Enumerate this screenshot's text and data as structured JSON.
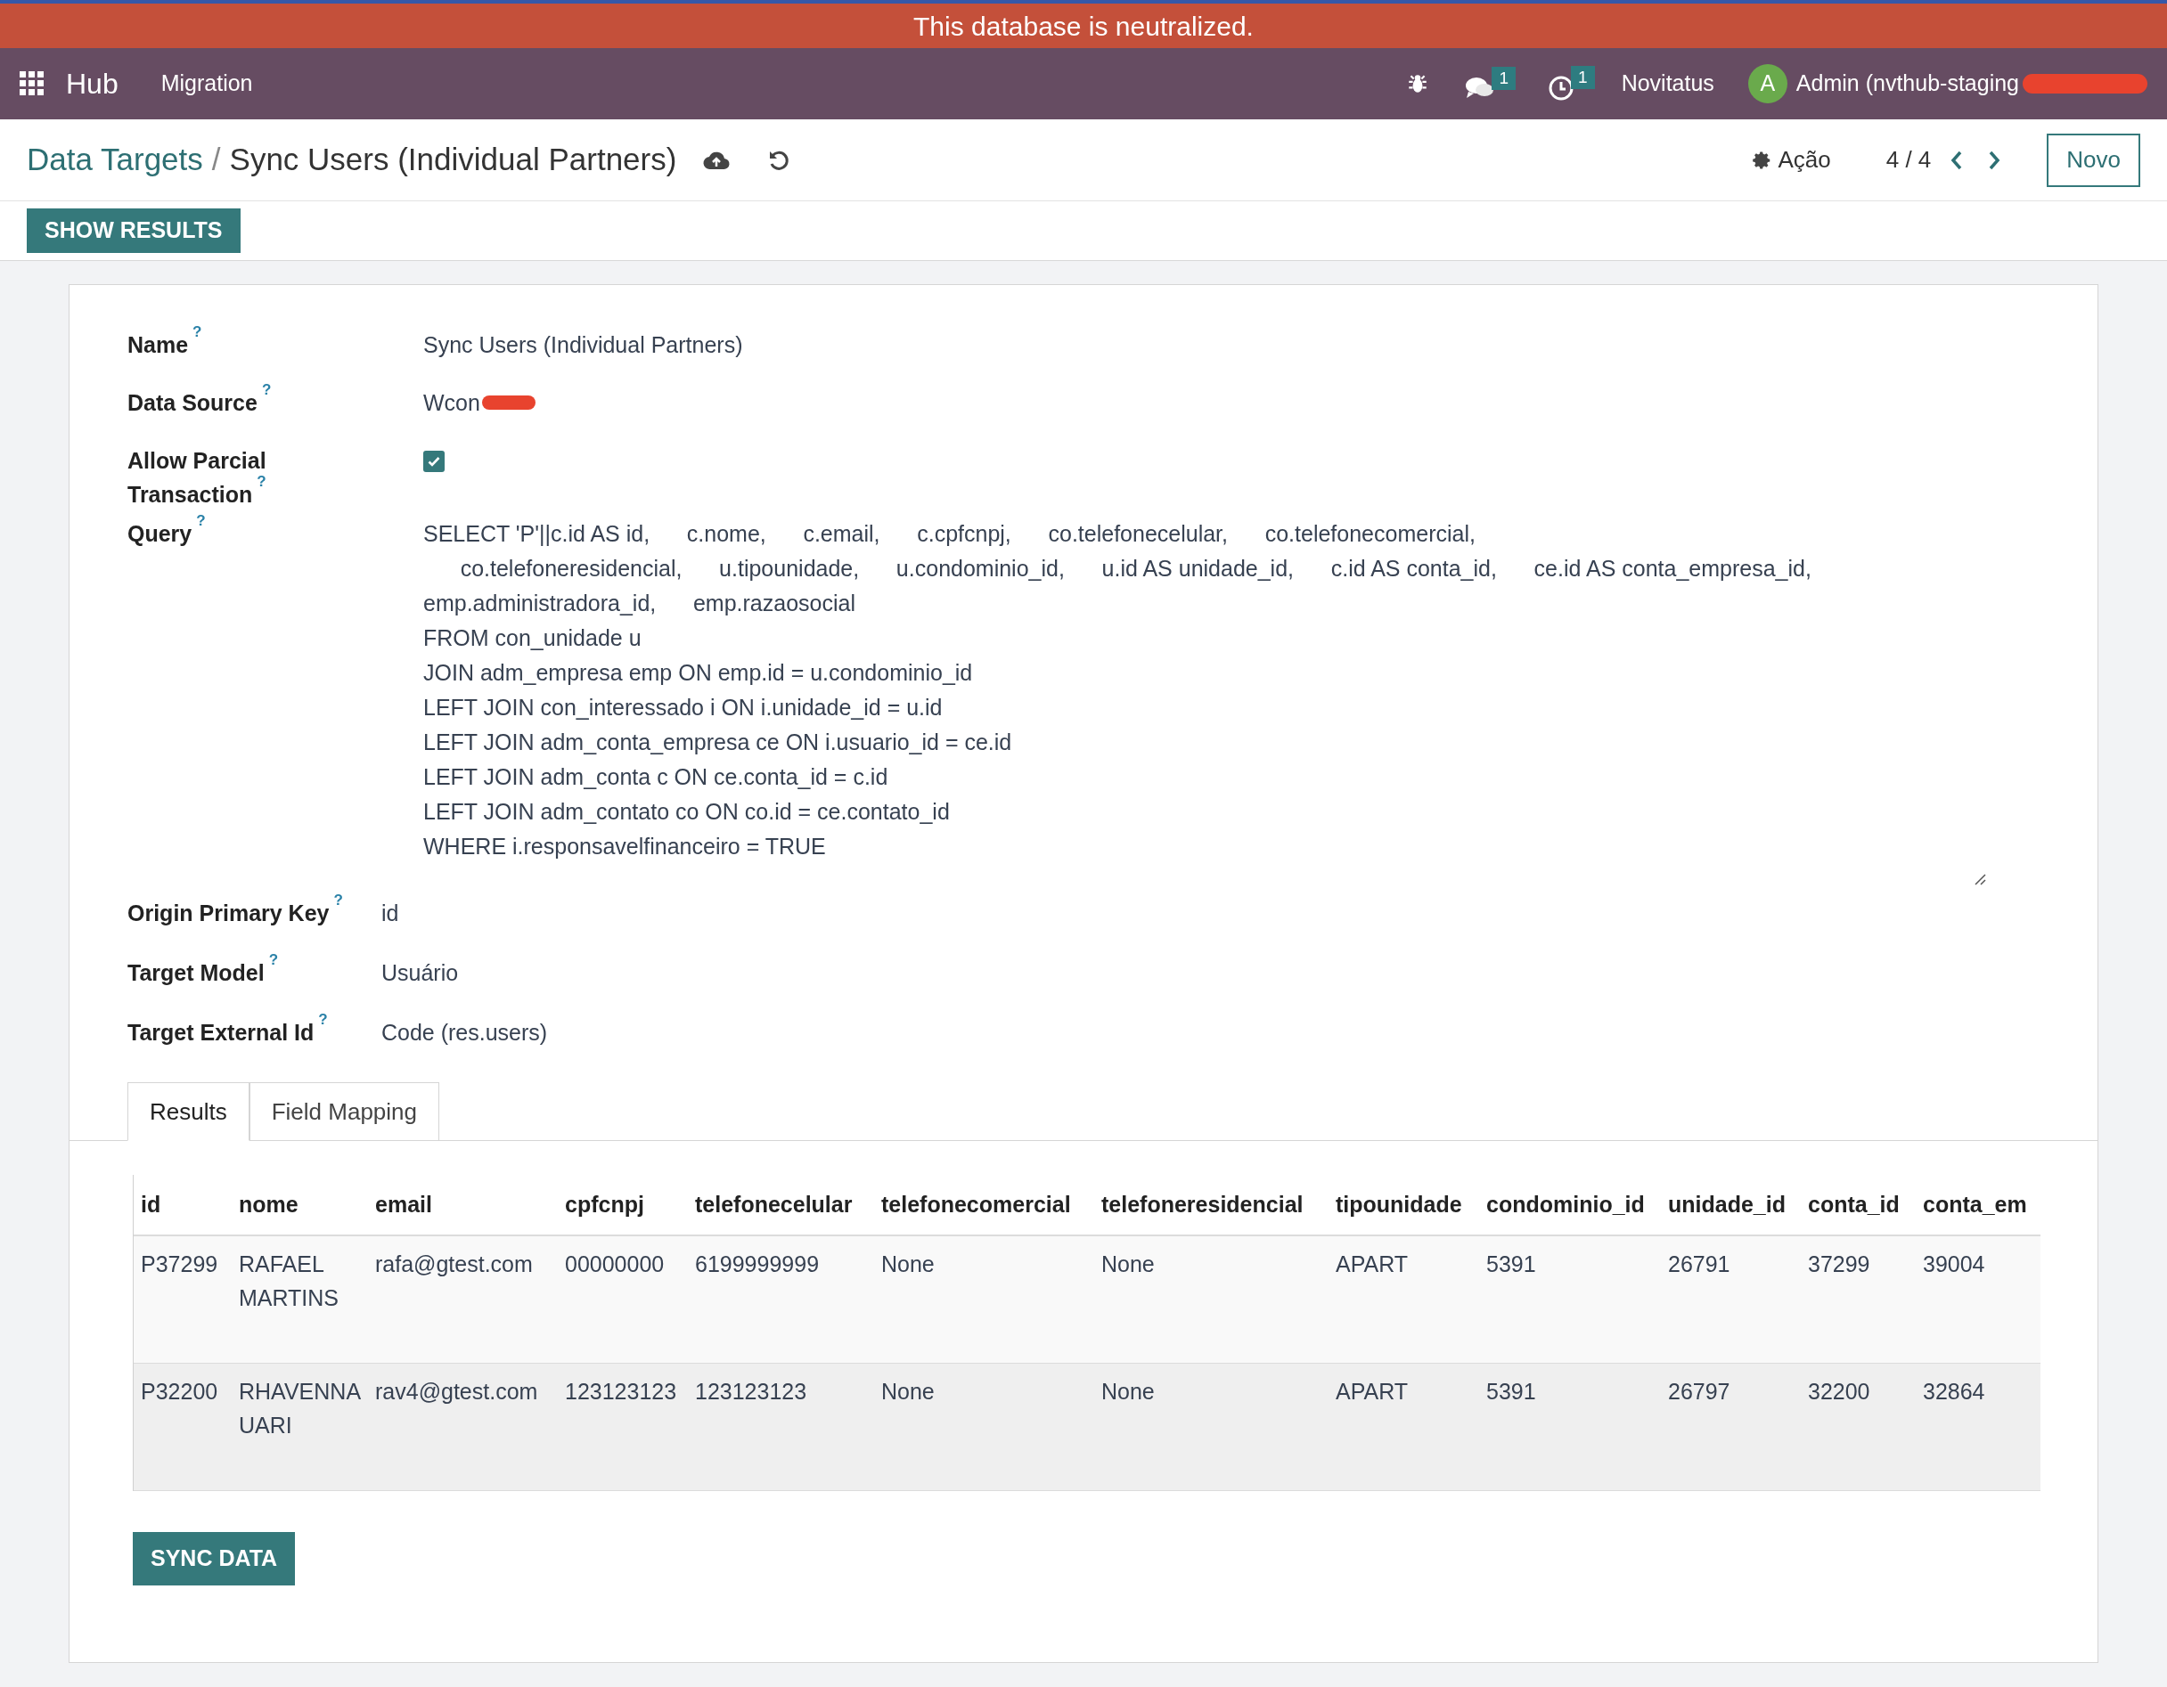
{
  "banner": {
    "text": "This database is neutralized."
  },
  "navbar": {
    "app": "Hub",
    "menus": [
      "Migration"
    ],
    "messages_count": "1",
    "activities_count": "1",
    "company": "Novitatus",
    "avatar_letter": "A",
    "user": "Admin (nvthub-staging"
  },
  "breadcrumb": {
    "parent": "Data Targets",
    "separator": "/",
    "current": "Sync Users (Individual Partners)"
  },
  "controls": {
    "action": "Ação",
    "pager": "4 / 4",
    "new_button": "Novo",
    "show_results": "SHOW RESULTS"
  },
  "form": {
    "fields": [
      {
        "kind": "text",
        "label": "Name",
        "value": "Sync Users (Individual Partners)"
      },
      {
        "kind": "redacted",
        "label": "Data Source",
        "value": "Wcon"
      },
      {
        "kind": "checkbox",
        "label": "Allow Parcial Transaction",
        "checked": true
      },
      {
        "kind": "query",
        "label": "Query",
        "lines": [
          "SELECT 'P'||c.id AS id,      c.nome,      c.email,      c.cpfcnpj,      co.telefonecelular,      co.telefonecomercial,",
          "      co.telefoneresidencial,      u.tipounidade,      u.condominio_id,      u.id AS unidade_id,      c.id AS conta_id,      ce.id AS conta_empresa_id,",
          "emp.administradora_id,      emp.razaosocial",
          "FROM con_unidade u",
          "JOIN adm_empresa emp ON emp.id = u.condominio_id",
          "LEFT JOIN con_interessado i ON i.unidade_id = u.id",
          "LEFT JOIN adm_conta_empresa ce ON i.usuario_id = ce.id",
          "LEFT JOIN adm_conta c ON ce.conta_id = c.id",
          "LEFT JOIN adm_contato co ON co.id = ce.contato_id",
          "WHERE i.responsavelfinanceiro = TRUE"
        ]
      },
      {
        "kind": "short",
        "label": "Origin Primary Key",
        "value": "id"
      },
      {
        "kind": "short",
        "label": "Target Model",
        "value": "Usuário"
      },
      {
        "kind": "short",
        "label": "Target External Id",
        "value": "Code (res.users)"
      }
    ],
    "help_mark": "?"
  },
  "tabs": [
    {
      "label": "Results",
      "selected": true
    },
    {
      "label": "Field Mapping",
      "selected": false
    }
  ],
  "table": {
    "columns": [
      "id",
      "nome",
      "email",
      "cpfcnpj",
      "telefonecelular",
      "telefonecomercial",
      "telefoneresidencial",
      "tipounidade",
      "condominio_id",
      "unidade_id",
      "conta_id",
      "conta_em"
    ],
    "rows": [
      [
        "P37299",
        "RAFAEL MARTINS",
        "rafa@gtest.com",
        "00000000",
        "6199999999",
        "None",
        "None",
        "APART",
        "5391",
        "26791",
        "37299",
        "39004"
      ],
      [
        "P32200",
        "RHAVENNA UARI",
        "rav4@gtest.com",
        "123123123",
        "123123123",
        "None",
        "None",
        "APART",
        "5391",
        "26797",
        "32200",
        "32864"
      ]
    ]
  },
  "sync_button": "SYNC DATA"
}
